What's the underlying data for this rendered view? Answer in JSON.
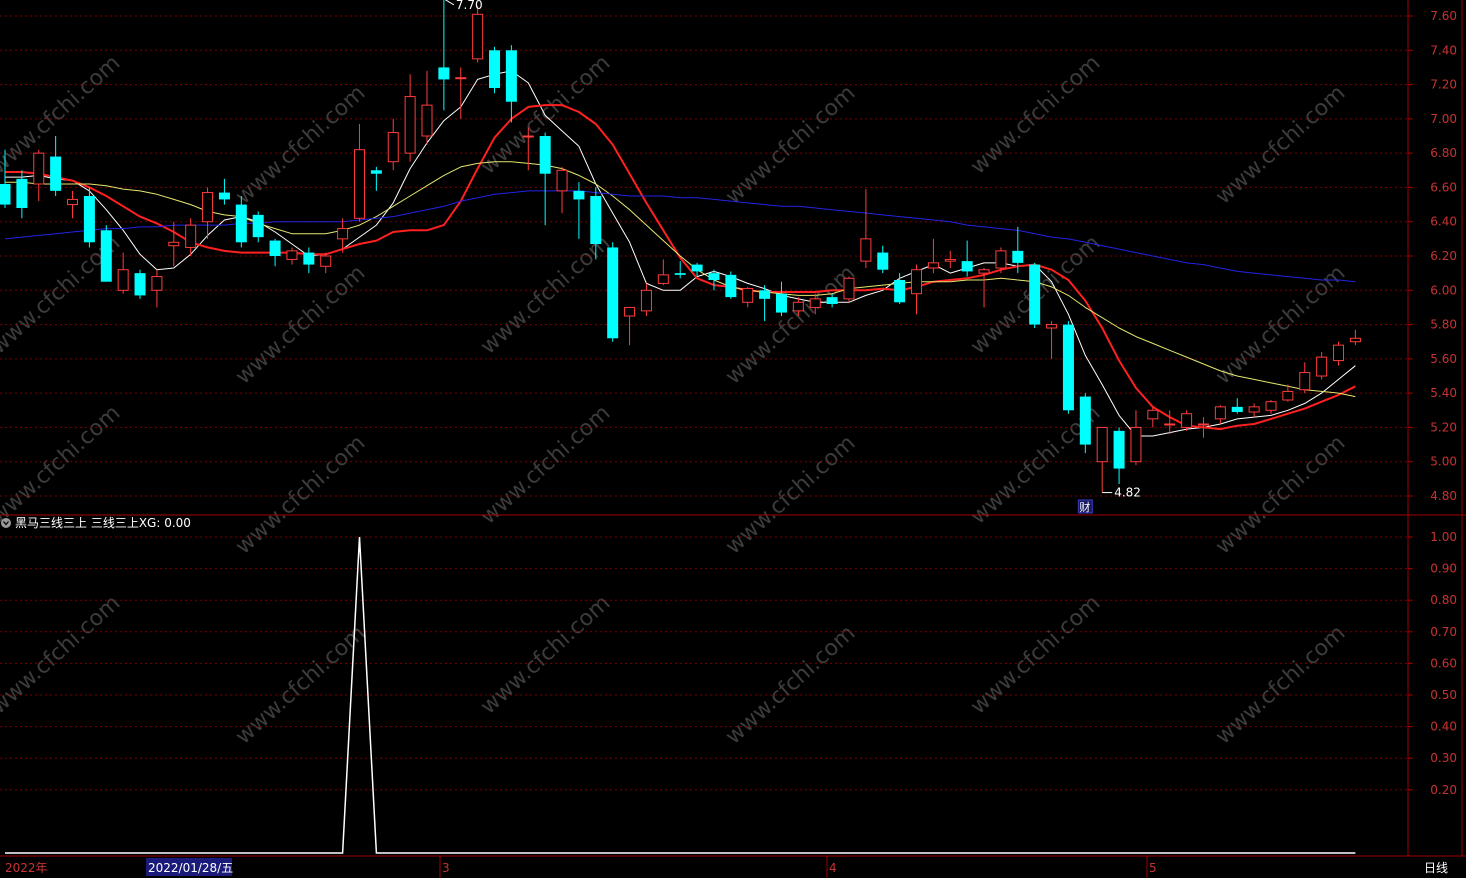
{
  "colors": {
    "background": "#000000",
    "grid": "#7a0000",
    "frame": "#a00000",
    "axis_text": "#c83232",
    "up": "#ff3c3c",
    "down": "#00ffff",
    "ma5": "#ffffff",
    "ma10": "#ff2020",
    "ma20": "#e6e66e",
    "ma60": "#2323e6",
    "indicator": "#ffffff",
    "watermark": "#3c3c3c"
  },
  "watermark_text": "www.cfchi.com",
  "indicator_header": {
    "icon": "collapse-icon",
    "text": "黑马三线三上 三线三上XG: 0.00"
  },
  "x_axis": {
    "labels": [
      "2022年",
      "3",
      "4",
      "5"
    ],
    "cursor_date": "2022/01/28/五",
    "period": "日线"
  },
  "chart_data": [
    {
      "type": "candlestick",
      "title": "",
      "ylim": [
        4.7,
        7.7
      ],
      "y_ticks": [
        "7.60",
        "7.40",
        "7.20",
        "7.00",
        "6.80",
        "6.60",
        "6.40",
        "6.20",
        "6.00",
        "5.80",
        "5.60",
        "5.40",
        "5.20",
        "5.00",
        "4.80"
      ],
      "annotations": {
        "high_label": "7.70",
        "low_label": "4.82",
        "event_marker": "财"
      },
      "grid": true,
      "candles": [
        {
          "o": 6.62,
          "h": 6.82,
          "l": 6.48,
          "c": 6.5
        },
        {
          "o": 6.65,
          "h": 6.7,
          "l": 6.42,
          "c": 6.48
        },
        {
          "o": 6.62,
          "h": 6.82,
          "l": 6.52,
          "c": 6.8
        },
        {
          "o": 6.78,
          "h": 6.9,
          "l": 6.55,
          "c": 6.58
        },
        {
          "o": 6.5,
          "h": 6.58,
          "l": 6.42,
          "c": 6.53
        },
        {
          "o": 6.55,
          "h": 6.6,
          "l": 6.25,
          "c": 6.28
        },
        {
          "o": 6.35,
          "h": 6.38,
          "l": 6.05,
          "c": 6.05
        },
        {
          "o": 6.0,
          "h": 6.22,
          "l": 5.98,
          "c": 6.12
        },
        {
          "o": 6.1,
          "h": 6.12,
          "l": 5.95,
          "c": 5.97
        },
        {
          "o": 6.0,
          "h": 6.12,
          "l": 5.9,
          "c": 6.08
        },
        {
          "o": 6.26,
          "h": 6.4,
          "l": 6.14,
          "c": 6.28
        },
        {
          "o": 6.25,
          "h": 6.42,
          "l": 6.2,
          "c": 6.38
        },
        {
          "o": 6.4,
          "h": 6.6,
          "l": 6.3,
          "c": 6.57
        },
        {
          "o": 6.57,
          "h": 6.65,
          "l": 6.5,
          "c": 6.53
        },
        {
          "o": 6.5,
          "h": 6.55,
          "l": 6.25,
          "c": 6.28
        },
        {
          "o": 6.44,
          "h": 6.46,
          "l": 6.28,
          "c": 6.31
        },
        {
          "o": 6.29,
          "h": 6.3,
          "l": 6.14,
          "c": 6.2
        },
        {
          "o": 6.18,
          "h": 6.25,
          "l": 6.15,
          "c": 6.23
        },
        {
          "o": 6.22,
          "h": 6.25,
          "l": 6.1,
          "c": 6.15
        },
        {
          "o": 6.14,
          "h": 6.22,
          "l": 6.1,
          "c": 6.2
        },
        {
          "o": 6.3,
          "h": 6.42,
          "l": 6.22,
          "c": 6.36
        },
        {
          "o": 6.42,
          "h": 6.97,
          "l": 6.4,
          "c": 6.82
        },
        {
          "o": 6.7,
          "h": 6.72,
          "l": 6.58,
          "c": 6.68
        },
        {
          "o": 6.75,
          "h": 7.0,
          "l": 6.7,
          "c": 6.92
        },
        {
          "o": 6.8,
          "h": 7.26,
          "l": 6.75,
          "c": 7.13
        },
        {
          "o": 6.9,
          "h": 7.28,
          "l": 6.85,
          "c": 7.08
        },
        {
          "o": 7.3,
          "h": 7.7,
          "l": 7.05,
          "c": 7.23
        },
        {
          "o": 7.24,
          "h": 7.3,
          "l": 7.0,
          "c": 7.24
        },
        {
          "o": 7.35,
          "h": 7.66,
          "l": 7.33,
          "c": 7.61
        },
        {
          "o": 7.4,
          "h": 7.42,
          "l": 7.15,
          "c": 7.18
        },
        {
          "o": 7.4,
          "h": 7.43,
          "l": 6.98,
          "c": 7.1
        },
        {
          "o": 6.9,
          "h": 6.95,
          "l": 6.7,
          "c": 6.9
        },
        {
          "o": 6.9,
          "h": 6.92,
          "l": 6.38,
          "c": 6.68
        },
        {
          "o": 6.58,
          "h": 6.72,
          "l": 6.45,
          "c": 6.7
        },
        {
          "o": 6.58,
          "h": 6.63,
          "l": 6.3,
          "c": 6.53
        },
        {
          "o": 6.55,
          "h": 6.6,
          "l": 6.18,
          "c": 6.27
        },
        {
          "o": 6.25,
          "h": 6.28,
          "l": 5.7,
          "c": 5.72
        },
        {
          "o": 5.85,
          "h": 5.9,
          "l": 5.68,
          "c": 5.9
        },
        {
          "o": 5.88,
          "h": 6.04,
          "l": 5.85,
          "c": 6.0
        },
        {
          "o": 6.04,
          "h": 6.18,
          "l": 6.03,
          "c": 6.09
        },
        {
          "o": 6.1,
          "h": 6.17,
          "l": 6.07,
          "c": 6.09
        },
        {
          "o": 6.15,
          "h": 6.16,
          "l": 6.08,
          "c": 6.11
        },
        {
          "o": 6.1,
          "h": 6.12,
          "l": 6.0,
          "c": 6.06
        },
        {
          "o": 6.09,
          "h": 6.11,
          "l": 5.95,
          "c": 5.96
        },
        {
          "o": 5.93,
          "h": 6.02,
          "l": 5.9,
          "c": 6.01
        },
        {
          "o": 6.0,
          "h": 6.03,
          "l": 5.82,
          "c": 5.95
        },
        {
          "o": 5.98,
          "h": 6.05,
          "l": 5.85,
          "c": 5.87
        },
        {
          "o": 5.88,
          "h": 5.96,
          "l": 5.85,
          "c": 5.93
        },
        {
          "o": 5.9,
          "h": 5.98,
          "l": 5.86,
          "c": 5.95
        },
        {
          "o": 5.96,
          "h": 5.98,
          "l": 5.9,
          "c": 5.92
        },
        {
          "o": 5.95,
          "h": 6.08,
          "l": 5.93,
          "c": 6.07
        },
        {
          "o": 6.17,
          "h": 6.59,
          "l": 6.13,
          "c": 6.3
        },
        {
          "o": 6.22,
          "h": 6.26,
          "l": 6.1,
          "c": 6.12
        },
        {
          "o": 6.06,
          "h": 6.1,
          "l": 5.92,
          "c": 5.93
        },
        {
          "o": 5.98,
          "h": 6.15,
          "l": 5.86,
          "c": 6.12
        },
        {
          "o": 6.13,
          "h": 6.3,
          "l": 6.1,
          "c": 6.16
        },
        {
          "o": 6.17,
          "h": 6.23,
          "l": 6.13,
          "c": 6.18
        },
        {
          "o": 6.17,
          "h": 6.29,
          "l": 6.08,
          "c": 6.11
        },
        {
          "o": 6.1,
          "h": 6.13,
          "l": 5.9,
          "c": 6.12
        },
        {
          "o": 6.13,
          "h": 6.25,
          "l": 6.1,
          "c": 6.23
        },
        {
          "o": 6.23,
          "h": 6.37,
          "l": 6.1,
          "c": 6.16
        },
        {
          "o": 6.15,
          "h": 6.16,
          "l": 5.78,
          "c": 5.8
        },
        {
          "o": 5.78,
          "h": 5.82,
          "l": 5.6,
          "c": 5.8
        },
        {
          "o": 5.8,
          "h": 5.82,
          "l": 5.28,
          "c": 5.3
        },
        {
          "o": 5.38,
          "h": 5.4,
          "l": 5.05,
          "c": 5.1
        },
        {
          "o": 5.0,
          "h": 5.2,
          "l": 4.82,
          "c": 5.2
        },
        {
          "o": 5.18,
          "h": 5.2,
          "l": 4.87,
          "c": 4.96
        },
        {
          "o": 5.0,
          "h": 5.3,
          "l": 4.98,
          "c": 5.2
        },
        {
          "o": 5.25,
          "h": 5.32,
          "l": 5.2,
          "c": 5.3
        },
        {
          "o": 5.22,
          "h": 5.3,
          "l": 5.16,
          "c": 5.22
        },
        {
          "o": 5.2,
          "h": 5.3,
          "l": 5.18,
          "c": 5.28
        },
        {
          "o": 5.22,
          "h": 5.26,
          "l": 5.14,
          "c": 5.22
        },
        {
          "o": 5.25,
          "h": 5.33,
          "l": 5.22,
          "c": 5.32
        },
        {
          "o": 5.32,
          "h": 5.37,
          "l": 5.28,
          "c": 5.29
        },
        {
          "o": 5.29,
          "h": 5.34,
          "l": 5.26,
          "c": 5.32
        },
        {
          "o": 5.3,
          "h": 5.36,
          "l": 5.28,
          "c": 5.35
        },
        {
          "o": 5.36,
          "h": 5.45,
          "l": 5.35,
          "c": 5.41
        },
        {
          "o": 5.42,
          "h": 5.58,
          "l": 5.4,
          "c": 5.52
        },
        {
          "o": 5.5,
          "h": 5.64,
          "l": 5.48,
          "c": 5.61
        },
        {
          "o": 5.59,
          "h": 5.7,
          "l": 5.56,
          "c": 5.68
        },
        {
          "o": 5.7,
          "h": 5.77,
          "l": 5.68,
          "c": 5.72
        }
      ],
      "series": [
        {
          "name": "MA5",
          "values": [
            6.66,
            6.66,
            6.67,
            6.65,
            6.64,
            6.58,
            6.47,
            6.35,
            6.21,
            6.12,
            6.13,
            6.21,
            6.32,
            6.41,
            6.43,
            6.4,
            6.34,
            6.27,
            6.2,
            6.21,
            6.24,
            6.31,
            6.38,
            6.51,
            6.71,
            6.86,
            6.99,
            7.07,
            7.23,
            7.26,
            7.28,
            7.21,
            7.02,
            6.93,
            6.84,
            6.62,
            6.45,
            6.28,
            6.04,
            6.0,
            6.0,
            6.08,
            6.11,
            6.08,
            6.04,
            6.01,
            5.97,
            5.95,
            5.93,
            5.93,
            5.93,
            5.97,
            6.0,
            6.07,
            6.11,
            6.15,
            6.1,
            6.13,
            6.16,
            6.16,
            6.14,
            6.15,
            6.05,
            5.86,
            5.62,
            5.45,
            5.27,
            5.15,
            5.15,
            5.17,
            5.19,
            5.2,
            5.22,
            5.25,
            5.26,
            5.27,
            5.3,
            5.34,
            5.4,
            5.48,
            5.56
          ]
        },
        {
          "name": "MA10",
          "values": [
            6.69,
            6.69,
            6.68,
            6.66,
            6.64,
            6.6,
            6.55,
            6.49,
            6.43,
            6.39,
            6.34,
            6.28,
            6.25,
            6.23,
            6.22,
            6.22,
            6.22,
            6.22,
            6.21,
            6.21,
            6.24,
            6.27,
            6.29,
            6.34,
            6.35,
            6.35,
            6.38,
            6.52,
            6.71,
            6.89,
            7.0,
            7.07,
            7.08,
            7.08,
            7.04,
            6.97,
            6.85,
            6.68,
            6.51,
            6.35,
            6.19,
            6.07,
            6.03,
            6.02,
            6.0,
            5.99,
            5.99,
            5.99,
            5.99,
            6.0,
            6.0,
            6.0,
            6.01,
            6.0,
            6.02,
            6.05,
            6.06,
            6.07,
            6.09,
            6.12,
            6.14,
            6.15,
            6.12,
            6.06,
            5.94,
            5.78,
            5.59,
            5.43,
            5.32,
            5.26,
            5.21,
            5.2,
            5.19,
            5.21,
            5.22,
            5.25,
            5.28,
            5.31,
            5.35,
            5.39,
            5.44
          ]
        },
        {
          "name": "MA20",
          "values": [
            6.63,
            6.63,
            6.62,
            6.62,
            6.62,
            6.62,
            6.61,
            6.59,
            6.58,
            6.56,
            6.53,
            6.5,
            6.46,
            6.44,
            6.43,
            6.39,
            6.36,
            6.33,
            6.33,
            6.33,
            6.35,
            6.38,
            6.43,
            6.49,
            6.55,
            6.61,
            6.67,
            6.72,
            6.74,
            6.75,
            6.75,
            6.74,
            6.73,
            6.71,
            6.67,
            6.62,
            6.55,
            6.47,
            6.38,
            6.29,
            6.2,
            6.12,
            6.06,
            6.02,
            6.0,
            5.99,
            5.98,
            5.97,
            5.97,
            5.98,
            6.01,
            6.02,
            6.03,
            6.04,
            6.05,
            6.05,
            6.05,
            6.06,
            6.06,
            6.07,
            6.06,
            6.05,
            6.02,
            5.97,
            5.9,
            5.84,
            5.78,
            5.73,
            5.69,
            5.65,
            5.61,
            5.57,
            5.53,
            5.5,
            5.48,
            5.46,
            5.44,
            5.42,
            5.41,
            5.4,
            5.38
          ]
        },
        {
          "name": "MA60",
          "values": [
            6.3,
            6.31,
            6.32,
            6.33,
            6.34,
            6.35,
            6.36,
            6.36,
            6.37,
            6.37,
            6.38,
            6.38,
            6.38,
            6.38,
            6.39,
            6.39,
            6.4,
            6.4,
            6.4,
            6.4,
            6.4,
            6.41,
            6.42,
            6.43,
            6.45,
            6.47,
            6.49,
            6.52,
            6.54,
            6.56,
            6.57,
            6.58,
            6.58,
            6.58,
            6.58,
            6.57,
            6.56,
            6.55,
            6.55,
            6.55,
            6.54,
            6.54,
            6.53,
            6.52,
            6.51,
            6.5,
            6.49,
            6.49,
            6.48,
            6.47,
            6.46,
            6.45,
            6.44,
            6.43,
            6.42,
            6.41,
            6.4,
            6.38,
            6.37,
            6.36,
            6.35,
            6.33,
            6.31,
            6.3,
            6.28,
            6.26,
            6.24,
            6.22,
            6.2,
            6.18,
            6.16,
            6.15,
            6.13,
            6.11,
            6.1,
            6.09,
            6.08,
            6.07,
            6.06,
            6.06,
            6.05
          ]
        }
      ]
    },
    {
      "type": "line",
      "title": "",
      "ylim": [
        0,
        1.0
      ],
      "y_ticks": [
        "1.00",
        "0.90",
        "0.80",
        "0.70",
        "0.60",
        "0.50",
        "0.40",
        "0.30",
        "0.20"
      ],
      "grid": true,
      "series": [
        {
          "name": "三线三上XG",
          "values": [
            0,
            0,
            0,
            0,
            0,
            0,
            0,
            0,
            0,
            0,
            0,
            0,
            0,
            0,
            0,
            0,
            0,
            0,
            0,
            0,
            0,
            1,
            0,
            0,
            0,
            0,
            0,
            0,
            0,
            0,
            0,
            0,
            0,
            0,
            0,
            0,
            0,
            0,
            0,
            0,
            0,
            0,
            0,
            0,
            0,
            0,
            0,
            0,
            0,
            0,
            0,
            0,
            0,
            0,
            0,
            0,
            0,
            0,
            0,
            0,
            0,
            0,
            0,
            0,
            0,
            0,
            0,
            0,
            0,
            0,
            0,
            0,
            0,
            0,
            0,
            0,
            0,
            0,
            0,
            0,
            0
          ]
        }
      ]
    }
  ]
}
